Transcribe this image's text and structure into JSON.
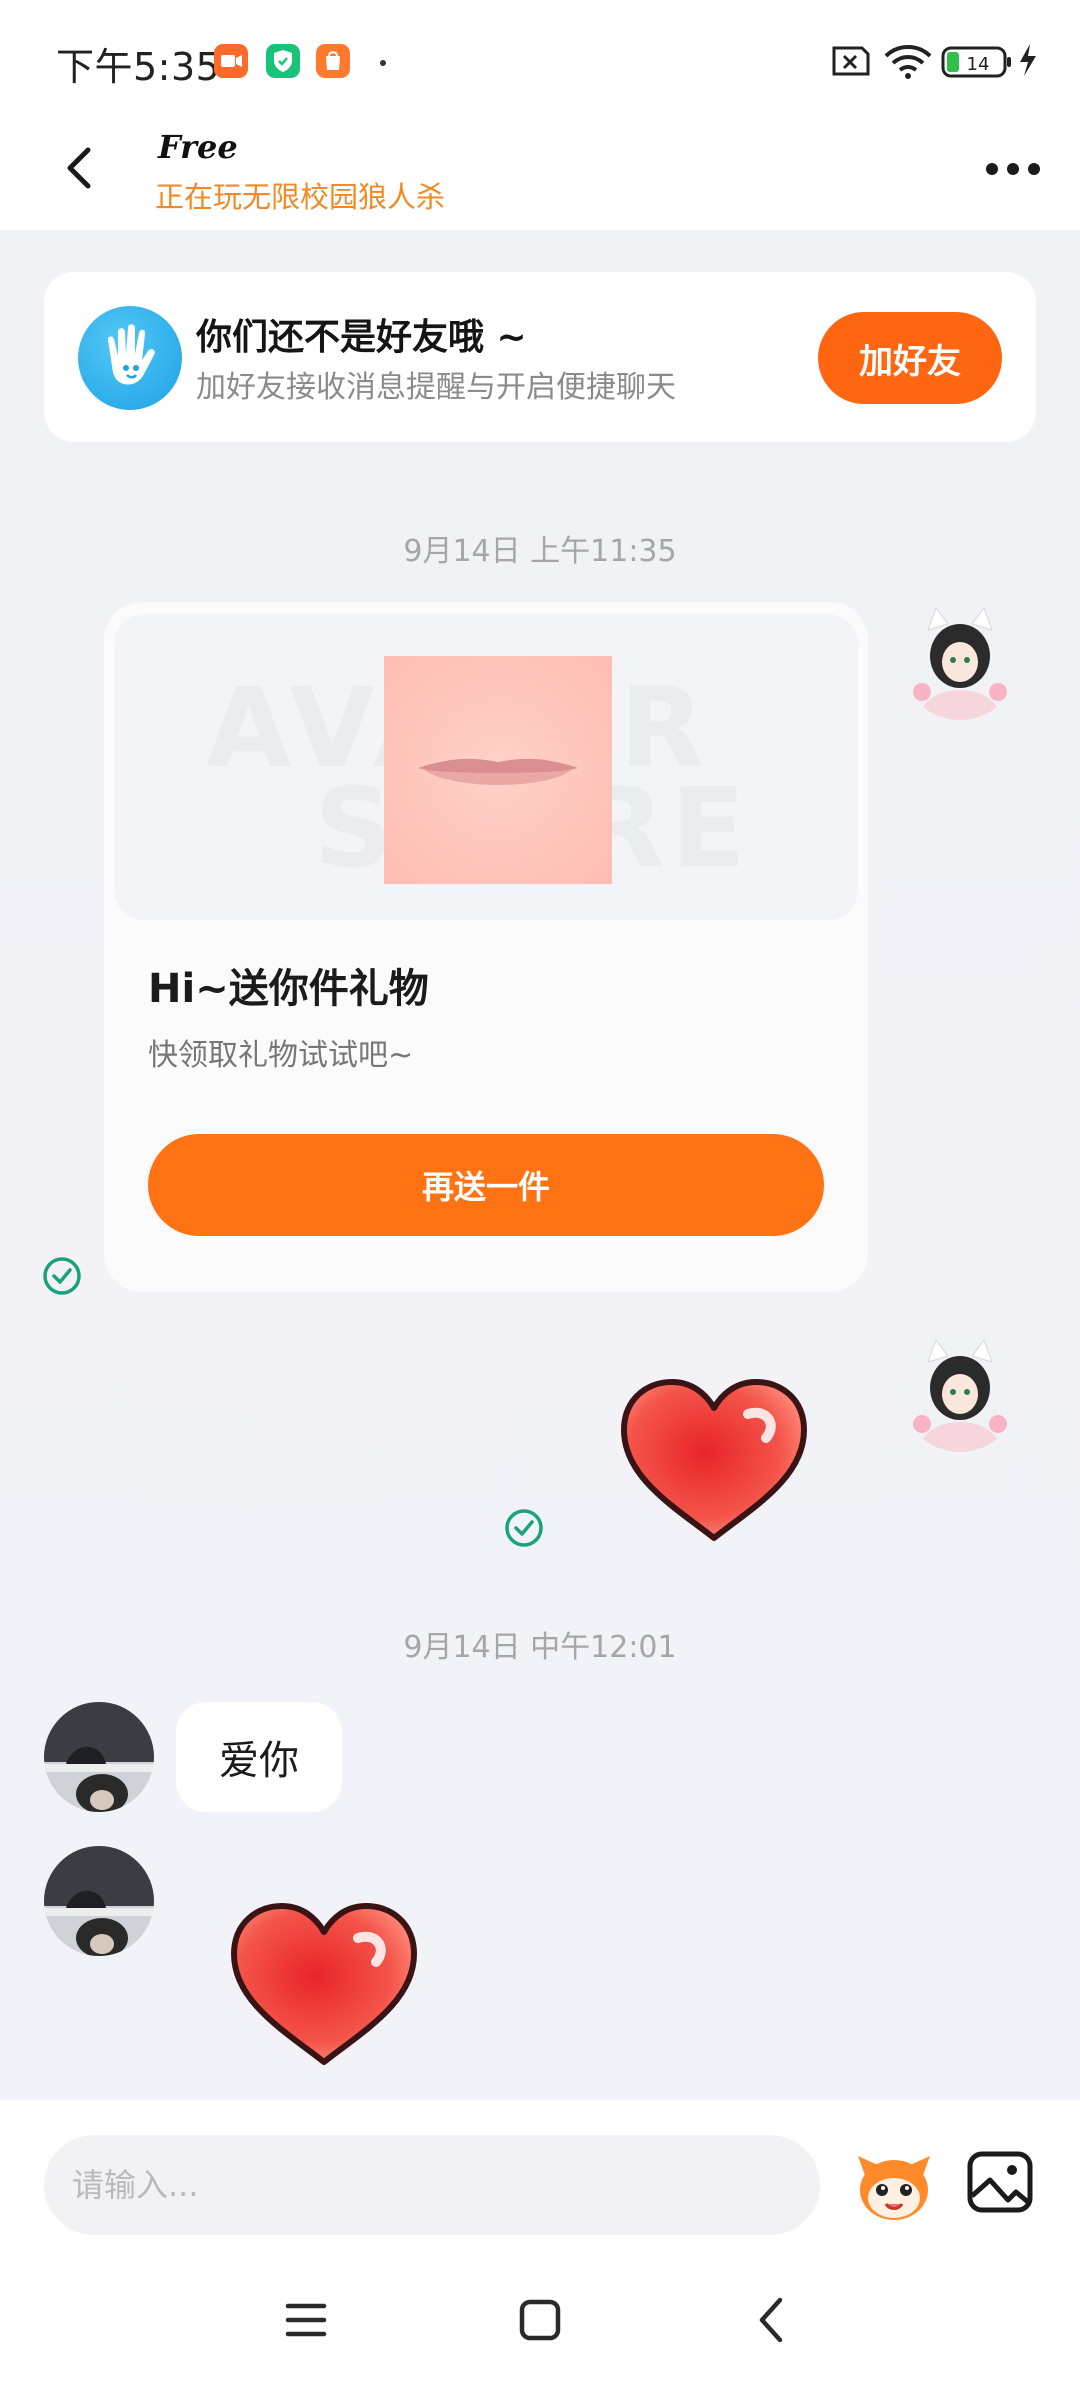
{
  "status_bar": {
    "time": "下午5:35",
    "battery": "14"
  },
  "header": {
    "name": "Free",
    "status": "正在玩无限校园狼人杀"
  },
  "friend_banner": {
    "title": "你们还不是好友哦 ~",
    "subtitle": "加好友接收消息提醒与开启便捷聊天",
    "button": "加好友"
  },
  "messages": {
    "timestamp_1": "9月14日 上午11:35",
    "gift_card": {
      "watermark_line1": "AVATAR",
      "watermark_line2": "STORE",
      "title": "Hi~送你件礼物",
      "description": "快领取礼物试试吧~",
      "button": "再送一件"
    },
    "timestamp_2": "9月14日 中午12:01",
    "received_text": "爱你"
  },
  "input_bar": {
    "placeholder": "请输入..."
  },
  "colors": {
    "accent_orange": "#ff6612",
    "status_orange": "#f08a24",
    "read_check_green": "#1aa37a"
  },
  "icons": {
    "back": "chevron-left-icon",
    "more": "more-dots-icon",
    "banner": "waving-hand-icon",
    "read": "check-circle-icon",
    "emoji": "emoji-mascot-icon",
    "image": "image-icon",
    "nav_menu": "menu-lines-icon",
    "nav_home": "square-home-icon",
    "nav_back": "triangle-back-icon"
  }
}
